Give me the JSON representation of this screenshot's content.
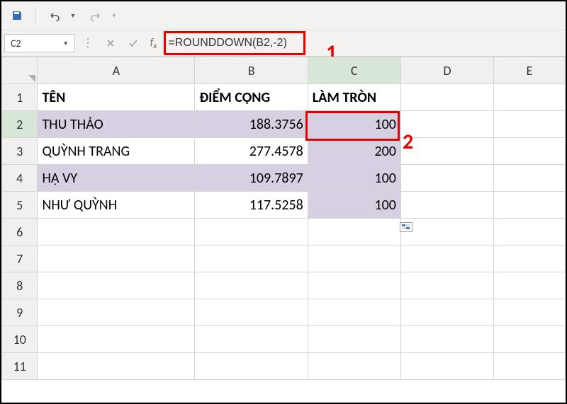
{
  "toolbar": {
    "save": "save",
    "undo": "undo",
    "redo": "redo"
  },
  "nameBox": "C2",
  "formula": "=ROUNDDOWN(B2,-2)",
  "callouts": {
    "one": "1",
    "two": "2"
  },
  "columns": [
    "A",
    "B",
    "C",
    "D",
    "E"
  ],
  "rowNumbers": [
    "1",
    "2",
    "3",
    "4",
    "5",
    "6",
    "7",
    "8",
    "9",
    "10",
    "11"
  ],
  "headers": {
    "a": "TÊN",
    "b": "ĐIỂM CỘNG",
    "c": "LÀM TRÒN"
  },
  "rows": [
    {
      "name": "THU THẢO",
      "score": "188.3756",
      "round": "100"
    },
    {
      "name": "QUỲNH TRANG",
      "score": "277.4578",
      "round": "200"
    },
    {
      "name": "HẠ VY",
      "score": "109.7897",
      "round": "100"
    },
    {
      "name": "NHƯ QUỲNH",
      "score": "117.5258",
      "round": "100"
    }
  ]
}
